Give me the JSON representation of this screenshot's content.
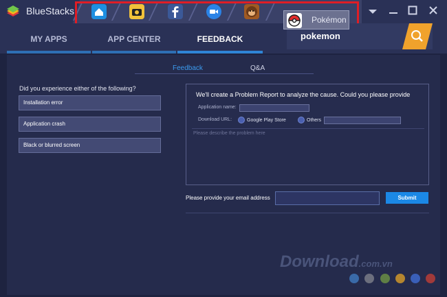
{
  "titlebar": {
    "brand": "BlueStacks",
    "pokemon_tab_label": "Pokémon",
    "app_tabs": [
      {
        "icon": "home-icon",
        "color": "#1e8fe0"
      },
      {
        "icon": "camera-icon",
        "color": "#f2c23a"
      },
      {
        "icon": "facebook-icon",
        "color": "#3b5998"
      },
      {
        "icon": "video-call-icon",
        "color": "#2b83e6"
      },
      {
        "icon": "monkey-game-icon",
        "color": "#a05a22"
      }
    ],
    "highlight_color": "#e01d25"
  },
  "nav": {
    "tabs": [
      "MY APPS",
      "APP CENTER",
      "FEEDBACK"
    ],
    "active": "FEEDBACK",
    "search_value": "pokemon"
  },
  "feedback": {
    "subtabs": [
      "Feedback",
      "Q&A"
    ],
    "active_subtab": "Feedback",
    "question": "Did you experience either of the following?",
    "options": [
      "Installation error",
      "Application crash",
      "Black or blurred screen"
    ],
    "report_title": "We'll create a Problem Report to analyze the cause. Could you please provide",
    "app_name_label": "Application name:",
    "download_url_label": "Download URL:",
    "radio_google": "Google Play Store",
    "radio_others": "Others",
    "description_placeholder": "Please describe the problem here",
    "email_label": "Please provide your email address",
    "submit_label": "Submit"
  },
  "watermark": {
    "text": "Download",
    "suffix": ".com.vn",
    "dot_colors": [
      "#3a6aa8",
      "#6c6f7e",
      "#5f7f45",
      "#b5862f",
      "#3a5fb8",
      "#a13a3a"
    ]
  },
  "colors": {
    "accent": "#2f85d6",
    "search_button": "#f0a22c",
    "submit": "#1b88e6"
  }
}
